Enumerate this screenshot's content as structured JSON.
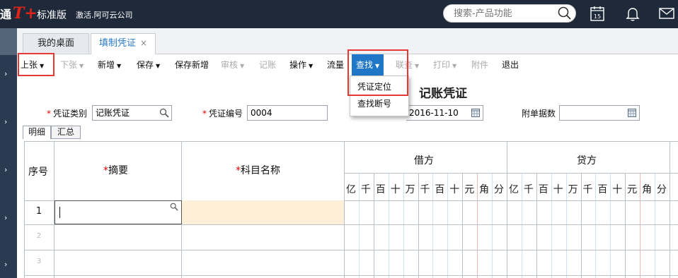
{
  "app": {
    "logo_prefix": "通",
    "logo_text": "T+",
    "product": "标准版",
    "activate": "激活.阿可云公司"
  },
  "search": {
    "placeholder": "搜索-产品功能"
  },
  "top_icons": [
    "calendar-icon",
    "bell-icon",
    "mail-icon"
  ],
  "calendar_day": "15",
  "tabs": [
    {
      "label": "我的桌面"
    },
    {
      "label": "填制凭证",
      "close": "×"
    }
  ],
  "toolbar": {
    "items": [
      {
        "label": "上张",
        "caret": "▼",
        "enabled": true
      },
      {
        "label": "下张",
        "caret": "▼",
        "enabled": false
      },
      {
        "label": "新增",
        "caret": "▼",
        "enabled": true
      },
      {
        "label": "保存",
        "caret": "▼",
        "enabled": true
      },
      {
        "label": "保存新增",
        "enabled": true
      },
      {
        "label": "审核",
        "caret": "▼",
        "enabled": false
      },
      {
        "label": "记账",
        "enabled": false
      },
      {
        "label": "操作",
        "caret": "▼",
        "enabled": true
      },
      {
        "label": "流量",
        "enabled": true
      },
      {
        "label": "查找",
        "caret": "▼",
        "enabled": true,
        "active": true
      },
      {
        "label": "联查",
        "caret": "▼",
        "enabled": false
      },
      {
        "label": "打印",
        "caret": "▼",
        "enabled": false
      },
      {
        "label": "附件",
        "enabled": false
      },
      {
        "label": "退出",
        "enabled": true
      }
    ]
  },
  "find_menu": [
    "凭证定位",
    "查找断号"
  ],
  "voucher": {
    "title": "记账凭证",
    "type_label": "凭证类别",
    "type_value": "记账凭证",
    "number_label": "凭证编号",
    "number_value": "0004",
    "date_value": "2016-11-10",
    "attachments_label": "附单据数",
    "attachments_value": ""
  },
  "subtabs": [
    "明细",
    "汇总"
  ],
  "grid": {
    "col_seq": "序号",
    "col_summary": "摘要",
    "col_account": "科目名称",
    "col_debit": "借方",
    "col_credit": "贷方",
    "digits": [
      "亿",
      "千",
      "百",
      "十",
      "万",
      "千",
      "百",
      "十",
      "元",
      "角",
      "分"
    ],
    "rows": [
      "1",
      "2",
      "3"
    ]
  },
  "colors": {
    "accent": "#2177c7",
    "highlight_box": "#e53935",
    "topbar": "#1e2a3a",
    "account_cell": "#fdefd8"
  }
}
